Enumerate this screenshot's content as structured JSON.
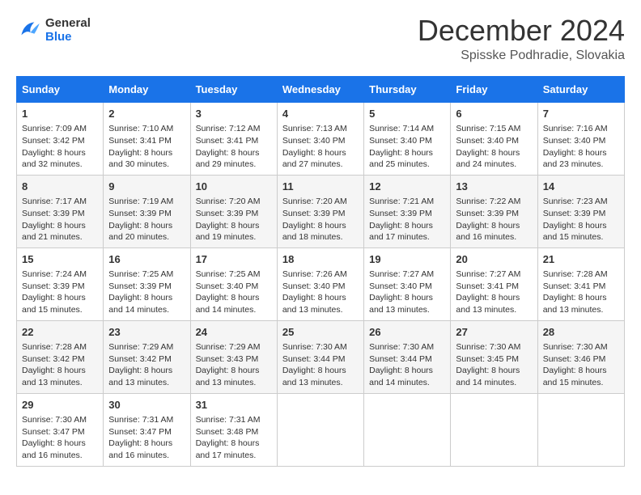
{
  "header": {
    "logo_line1": "General",
    "logo_line2": "Blue",
    "month": "December 2024",
    "location": "Spisske Podhradie, Slovakia"
  },
  "days_of_week": [
    "Sunday",
    "Monday",
    "Tuesday",
    "Wednesday",
    "Thursday",
    "Friday",
    "Saturday"
  ],
  "weeks": [
    [
      {
        "day": 1,
        "sunrise": "7:09 AM",
        "sunset": "3:42 PM",
        "daylight": "8 hours and 32 minutes."
      },
      {
        "day": 2,
        "sunrise": "7:10 AM",
        "sunset": "3:41 PM",
        "daylight": "8 hours and 30 minutes."
      },
      {
        "day": 3,
        "sunrise": "7:12 AM",
        "sunset": "3:41 PM",
        "daylight": "8 hours and 29 minutes."
      },
      {
        "day": 4,
        "sunrise": "7:13 AM",
        "sunset": "3:40 PM",
        "daylight": "8 hours and 27 minutes."
      },
      {
        "day": 5,
        "sunrise": "7:14 AM",
        "sunset": "3:40 PM",
        "daylight": "8 hours and 25 minutes."
      },
      {
        "day": 6,
        "sunrise": "7:15 AM",
        "sunset": "3:40 PM",
        "daylight": "8 hours and 24 minutes."
      },
      {
        "day": 7,
        "sunrise": "7:16 AM",
        "sunset": "3:40 PM",
        "daylight": "8 hours and 23 minutes."
      }
    ],
    [
      {
        "day": 8,
        "sunrise": "7:17 AM",
        "sunset": "3:39 PM",
        "daylight": "8 hours and 21 minutes."
      },
      {
        "day": 9,
        "sunrise": "7:19 AM",
        "sunset": "3:39 PM",
        "daylight": "8 hours and 20 minutes."
      },
      {
        "day": 10,
        "sunrise": "7:20 AM",
        "sunset": "3:39 PM",
        "daylight": "8 hours and 19 minutes."
      },
      {
        "day": 11,
        "sunrise": "7:20 AM",
        "sunset": "3:39 PM",
        "daylight": "8 hours and 18 minutes."
      },
      {
        "day": 12,
        "sunrise": "7:21 AM",
        "sunset": "3:39 PM",
        "daylight": "8 hours and 17 minutes."
      },
      {
        "day": 13,
        "sunrise": "7:22 AM",
        "sunset": "3:39 PM",
        "daylight": "8 hours and 16 minutes."
      },
      {
        "day": 14,
        "sunrise": "7:23 AM",
        "sunset": "3:39 PM",
        "daylight": "8 hours and 15 minutes."
      }
    ],
    [
      {
        "day": 15,
        "sunrise": "7:24 AM",
        "sunset": "3:39 PM",
        "daylight": "8 hours and 15 minutes."
      },
      {
        "day": 16,
        "sunrise": "7:25 AM",
        "sunset": "3:39 PM",
        "daylight": "8 hours and 14 minutes."
      },
      {
        "day": 17,
        "sunrise": "7:25 AM",
        "sunset": "3:40 PM",
        "daylight": "8 hours and 14 minutes."
      },
      {
        "day": 18,
        "sunrise": "7:26 AM",
        "sunset": "3:40 PM",
        "daylight": "8 hours and 13 minutes."
      },
      {
        "day": 19,
        "sunrise": "7:27 AM",
        "sunset": "3:40 PM",
        "daylight": "8 hours and 13 minutes."
      },
      {
        "day": 20,
        "sunrise": "7:27 AM",
        "sunset": "3:41 PM",
        "daylight": "8 hours and 13 minutes."
      },
      {
        "day": 21,
        "sunrise": "7:28 AM",
        "sunset": "3:41 PM",
        "daylight": "8 hours and 13 minutes."
      }
    ],
    [
      {
        "day": 22,
        "sunrise": "7:28 AM",
        "sunset": "3:42 PM",
        "daylight": "8 hours and 13 minutes."
      },
      {
        "day": 23,
        "sunrise": "7:29 AM",
        "sunset": "3:42 PM",
        "daylight": "8 hours and 13 minutes."
      },
      {
        "day": 24,
        "sunrise": "7:29 AM",
        "sunset": "3:43 PM",
        "daylight": "8 hours and 13 minutes."
      },
      {
        "day": 25,
        "sunrise": "7:30 AM",
        "sunset": "3:44 PM",
        "daylight": "8 hours and 13 minutes."
      },
      {
        "day": 26,
        "sunrise": "7:30 AM",
        "sunset": "3:44 PM",
        "daylight": "8 hours and 14 minutes."
      },
      {
        "day": 27,
        "sunrise": "7:30 AM",
        "sunset": "3:45 PM",
        "daylight": "8 hours and 14 minutes."
      },
      {
        "day": 28,
        "sunrise": "7:30 AM",
        "sunset": "3:46 PM",
        "daylight": "8 hours and 15 minutes."
      }
    ],
    [
      {
        "day": 29,
        "sunrise": "7:30 AM",
        "sunset": "3:47 PM",
        "daylight": "8 hours and 16 minutes."
      },
      {
        "day": 30,
        "sunrise": "7:31 AM",
        "sunset": "3:47 PM",
        "daylight": "8 hours and 16 minutes."
      },
      {
        "day": 31,
        "sunrise": "7:31 AM",
        "sunset": "3:48 PM",
        "daylight": "8 hours and 17 minutes."
      },
      null,
      null,
      null,
      null
    ]
  ]
}
